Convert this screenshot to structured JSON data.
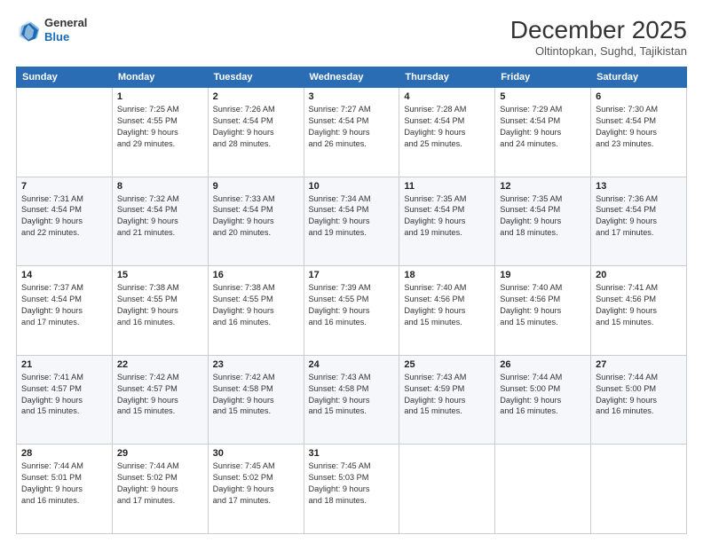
{
  "logo": {
    "line1": "General",
    "line2": "Blue"
  },
  "header": {
    "month": "December 2025",
    "location": "Oltintopkan, Sughd, Tajikistan"
  },
  "days_of_week": [
    "Sunday",
    "Monday",
    "Tuesday",
    "Wednesday",
    "Thursday",
    "Friday",
    "Saturday"
  ],
  "weeks": [
    [
      {
        "day": "",
        "info": ""
      },
      {
        "day": "1",
        "info": "Sunrise: 7:25 AM\nSunset: 4:55 PM\nDaylight: 9 hours\nand 29 minutes."
      },
      {
        "day": "2",
        "info": "Sunrise: 7:26 AM\nSunset: 4:54 PM\nDaylight: 9 hours\nand 28 minutes."
      },
      {
        "day": "3",
        "info": "Sunrise: 7:27 AM\nSunset: 4:54 PM\nDaylight: 9 hours\nand 26 minutes."
      },
      {
        "day": "4",
        "info": "Sunrise: 7:28 AM\nSunset: 4:54 PM\nDaylight: 9 hours\nand 25 minutes."
      },
      {
        "day": "5",
        "info": "Sunrise: 7:29 AM\nSunset: 4:54 PM\nDaylight: 9 hours\nand 24 minutes."
      },
      {
        "day": "6",
        "info": "Sunrise: 7:30 AM\nSunset: 4:54 PM\nDaylight: 9 hours\nand 23 minutes."
      }
    ],
    [
      {
        "day": "7",
        "info": "Sunrise: 7:31 AM\nSunset: 4:54 PM\nDaylight: 9 hours\nand 22 minutes."
      },
      {
        "day": "8",
        "info": "Sunrise: 7:32 AM\nSunset: 4:54 PM\nDaylight: 9 hours\nand 21 minutes."
      },
      {
        "day": "9",
        "info": "Sunrise: 7:33 AM\nSunset: 4:54 PM\nDaylight: 9 hours\nand 20 minutes."
      },
      {
        "day": "10",
        "info": "Sunrise: 7:34 AM\nSunset: 4:54 PM\nDaylight: 9 hours\nand 19 minutes."
      },
      {
        "day": "11",
        "info": "Sunrise: 7:35 AM\nSunset: 4:54 PM\nDaylight: 9 hours\nand 19 minutes."
      },
      {
        "day": "12",
        "info": "Sunrise: 7:35 AM\nSunset: 4:54 PM\nDaylight: 9 hours\nand 18 minutes."
      },
      {
        "day": "13",
        "info": "Sunrise: 7:36 AM\nSunset: 4:54 PM\nDaylight: 9 hours\nand 17 minutes."
      }
    ],
    [
      {
        "day": "14",
        "info": "Sunrise: 7:37 AM\nSunset: 4:54 PM\nDaylight: 9 hours\nand 17 minutes."
      },
      {
        "day": "15",
        "info": "Sunrise: 7:38 AM\nSunset: 4:55 PM\nDaylight: 9 hours\nand 16 minutes."
      },
      {
        "day": "16",
        "info": "Sunrise: 7:38 AM\nSunset: 4:55 PM\nDaylight: 9 hours\nand 16 minutes."
      },
      {
        "day": "17",
        "info": "Sunrise: 7:39 AM\nSunset: 4:55 PM\nDaylight: 9 hours\nand 16 minutes."
      },
      {
        "day": "18",
        "info": "Sunrise: 7:40 AM\nSunset: 4:56 PM\nDaylight: 9 hours\nand 15 minutes."
      },
      {
        "day": "19",
        "info": "Sunrise: 7:40 AM\nSunset: 4:56 PM\nDaylight: 9 hours\nand 15 minutes."
      },
      {
        "day": "20",
        "info": "Sunrise: 7:41 AM\nSunset: 4:56 PM\nDaylight: 9 hours\nand 15 minutes."
      }
    ],
    [
      {
        "day": "21",
        "info": "Sunrise: 7:41 AM\nSunset: 4:57 PM\nDaylight: 9 hours\nand 15 minutes."
      },
      {
        "day": "22",
        "info": "Sunrise: 7:42 AM\nSunset: 4:57 PM\nDaylight: 9 hours\nand 15 minutes."
      },
      {
        "day": "23",
        "info": "Sunrise: 7:42 AM\nSunset: 4:58 PM\nDaylight: 9 hours\nand 15 minutes."
      },
      {
        "day": "24",
        "info": "Sunrise: 7:43 AM\nSunset: 4:58 PM\nDaylight: 9 hours\nand 15 minutes."
      },
      {
        "day": "25",
        "info": "Sunrise: 7:43 AM\nSunset: 4:59 PM\nDaylight: 9 hours\nand 15 minutes."
      },
      {
        "day": "26",
        "info": "Sunrise: 7:44 AM\nSunset: 5:00 PM\nDaylight: 9 hours\nand 16 minutes."
      },
      {
        "day": "27",
        "info": "Sunrise: 7:44 AM\nSunset: 5:00 PM\nDaylight: 9 hours\nand 16 minutes."
      }
    ],
    [
      {
        "day": "28",
        "info": "Sunrise: 7:44 AM\nSunset: 5:01 PM\nDaylight: 9 hours\nand 16 minutes."
      },
      {
        "day": "29",
        "info": "Sunrise: 7:44 AM\nSunset: 5:02 PM\nDaylight: 9 hours\nand 17 minutes."
      },
      {
        "day": "30",
        "info": "Sunrise: 7:45 AM\nSunset: 5:02 PM\nDaylight: 9 hours\nand 17 minutes."
      },
      {
        "day": "31",
        "info": "Sunrise: 7:45 AM\nSunset: 5:03 PM\nDaylight: 9 hours\nand 18 minutes."
      },
      {
        "day": "",
        "info": ""
      },
      {
        "day": "",
        "info": ""
      },
      {
        "day": "",
        "info": ""
      }
    ]
  ]
}
